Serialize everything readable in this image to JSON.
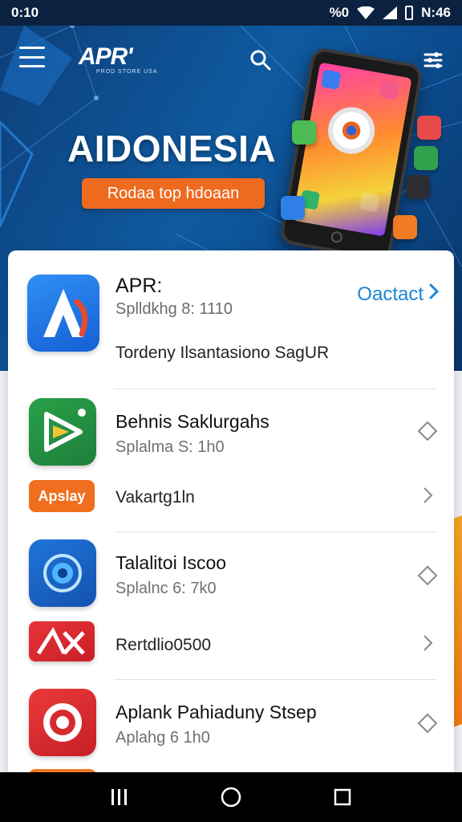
{
  "status_bar": {
    "time": "0:10",
    "right_text": "%0",
    "clock": "N:46"
  },
  "header": {
    "brand": "APR'",
    "brand_sub": "PROD STORE USA",
    "menu_icon": "hamburger-icon",
    "search_icon": "search-icon",
    "filter_icon": "filter-icon"
  },
  "hero": {
    "title": "AIDONESIA",
    "cta": "Rodaa top hdoaan"
  },
  "featured": {
    "name": "APR:",
    "meta": "Splldkhg 8: 1110",
    "description": "Tordeny Ilsantasiono SagUR",
    "action": "Oactact"
  },
  "apps": [
    {
      "title": "Behnis Saklurgahs",
      "sub": "Splalma S: 1h0",
      "pill": "Apslay",
      "sub_label": "Vakartg1ln"
    },
    {
      "title": "Talalitoi Iscoo",
      "sub": "Splalnc 6: 7k0",
      "pill": "",
      "sub_label": "Rertdlio0500"
    },
    {
      "title": "Aplank Pahiaduny Stsep",
      "sub": "Aplahg 6 1h0",
      "pill": "",
      "sub_label": ""
    }
  ],
  "colors": {
    "hero_blue": "#0f5aa0",
    "accent_orange": "#ee6a1f",
    "link_blue": "#1a86d6"
  }
}
